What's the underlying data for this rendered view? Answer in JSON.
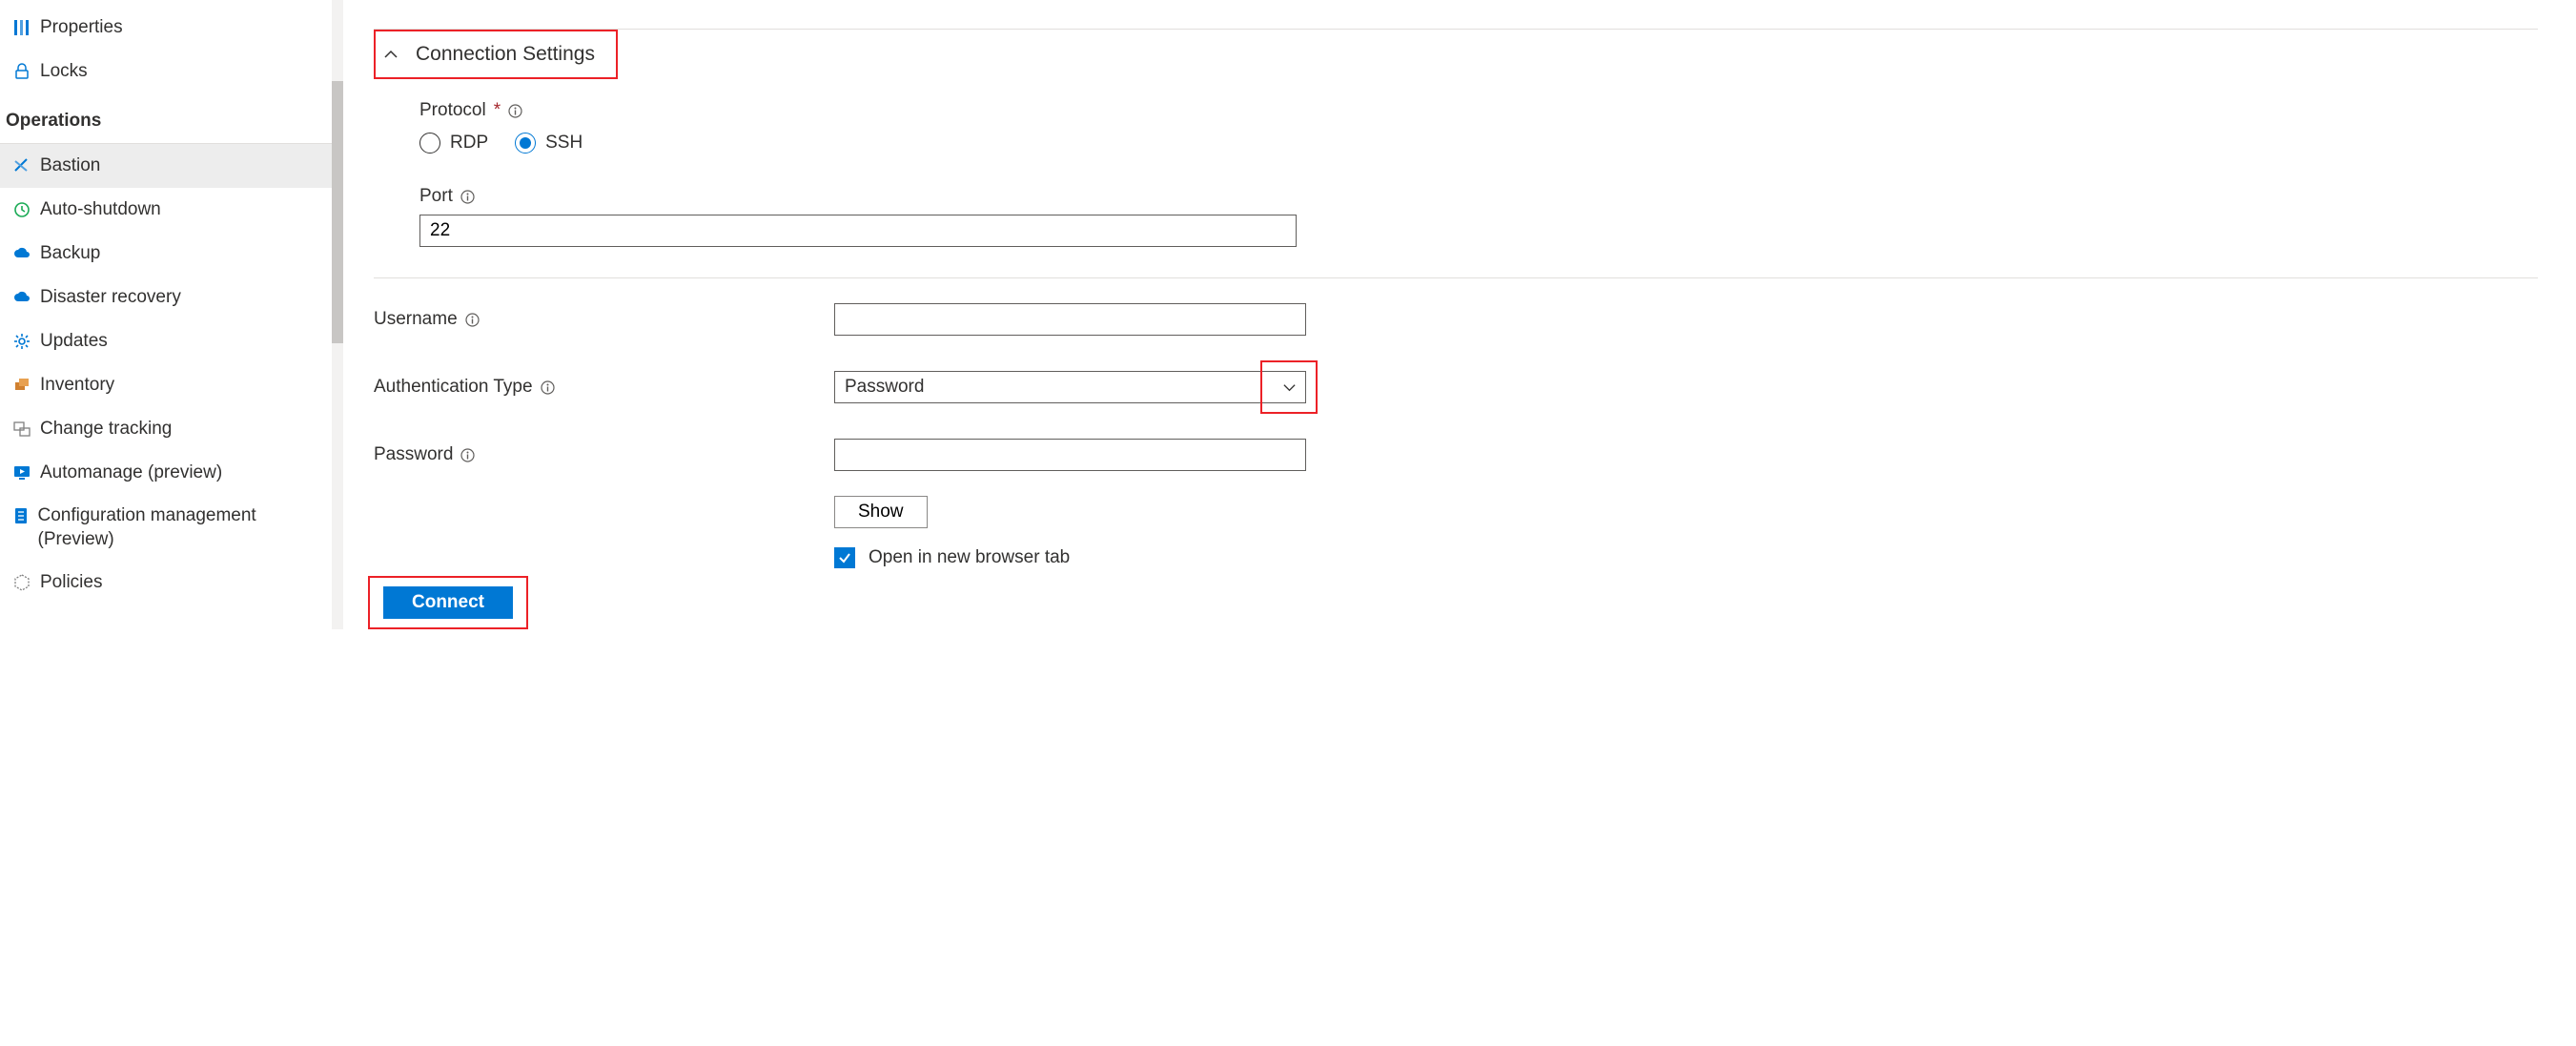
{
  "sidebar": {
    "top_items": [
      {
        "label": "Properties",
        "icon": "bars-blue"
      },
      {
        "label": "Locks",
        "icon": "lock-blue"
      }
    ],
    "section_header": "Operations",
    "ops_items": [
      {
        "label": "Bastion",
        "icon": "arrows-cross",
        "active": true
      },
      {
        "label": "Auto-shutdown",
        "icon": "clock-green"
      },
      {
        "label": "Backup",
        "icon": "cloud-blue"
      },
      {
        "label": "Disaster recovery",
        "icon": "cloud-blue"
      },
      {
        "label": "Updates",
        "icon": "gear-blue"
      },
      {
        "label": "Inventory",
        "icon": "box-stack"
      },
      {
        "label": "Change tracking",
        "icon": "windows-pair"
      },
      {
        "label": "Automanage (preview)",
        "icon": "monitor-play"
      },
      {
        "label": "Configuration management (Preview)",
        "icon": "clipboard-lines",
        "multiline": true
      },
      {
        "label": "Policies",
        "icon": "hex-outline"
      }
    ]
  },
  "main": {
    "expander_title": "Connection Settings",
    "protocol": {
      "label": "Protocol",
      "options": [
        "RDP",
        "SSH"
      ],
      "selected": "SSH"
    },
    "port": {
      "label": "Port",
      "value": "22"
    },
    "username": {
      "label": "Username",
      "value": ""
    },
    "auth": {
      "label": "Authentication Type",
      "value": "Password"
    },
    "password": {
      "label": "Password",
      "value": ""
    },
    "show_button": "Show",
    "new_tab": {
      "label": "Open in new browser tab",
      "checked": true
    },
    "connect_button": "Connect"
  }
}
